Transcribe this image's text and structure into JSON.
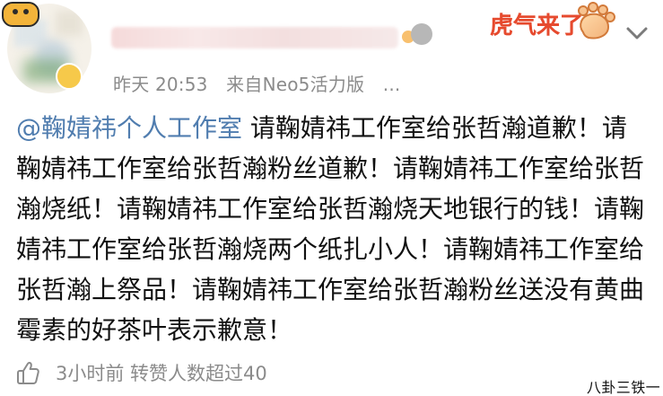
{
  "post": {
    "meta": {
      "timestamp": "昨天 20:53",
      "source": "来自Neo5活力版",
      "more_dots": "..."
    },
    "promo_badge_text": "虎气来了",
    "body": {
      "mention": "@鞠婧祎个人工作室",
      "text": " 请鞠婧祎工作室给张哲瀚道歉！请鞠婧祎工作室给张哲瀚粉丝道歉！请鞠婧祎工作室给张哲瀚烧纸！请鞠婧祎工作室给张哲瀚烧天地银行的钱！请鞠婧祎工作室给张哲瀚烧两个纸扎小人！请鞠婧祎工作室给张哲瀚上祭品！请鞠婧祎工作室给张哲瀚粉丝送没有黄曲霉素的好茶叶表示歉意！"
    },
    "footer": {
      "stats": "3小时前  转赞人数超过40"
    },
    "watermark": "八卦三铁一"
  },
  "icons": {
    "like": "thumb-up-icon",
    "chevron": "chevron-down-icon",
    "avatar": "avatar",
    "paw": "paw-icon",
    "medal": "medal-icon"
  },
  "colors": {
    "meta_gray": "#8b8b8b",
    "mention_blue": "#507daf",
    "promo_red": "#e64a2e",
    "text_dark": "#111111"
  }
}
